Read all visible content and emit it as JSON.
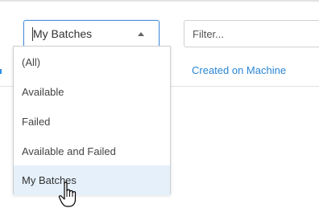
{
  "batch_select": {
    "value": "My Batches",
    "options": [
      "(All)",
      "Available",
      "Failed",
      "Available and Failed",
      "My Batches"
    ],
    "selected_index": 4
  },
  "filter": {
    "placeholder": "Filter..."
  },
  "columns": {
    "created_on_machine": "Created on Machine"
  },
  "colors": {
    "accent": "#2a86d6",
    "selected_bg": "#e5f0fa",
    "border_focus": "#4a90d9"
  },
  "icons": {
    "select_arrow": "chevron-up-icon",
    "cursor": "hand-pointer-icon"
  }
}
